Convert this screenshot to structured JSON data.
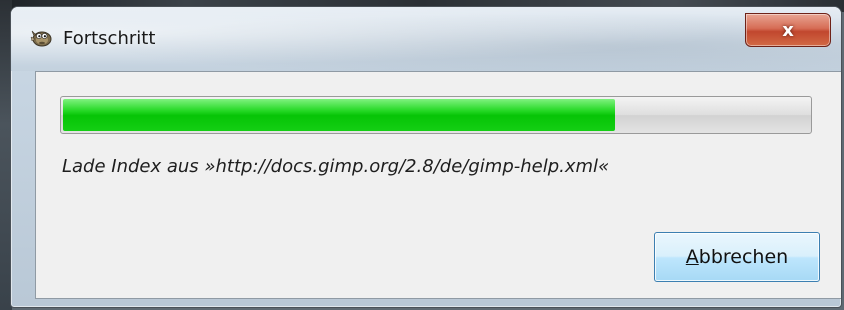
{
  "window": {
    "title": "Fortschritt",
    "app_icon": "gimp-wilber-icon",
    "close_glyph": "x"
  },
  "progress": {
    "fraction": 0.74,
    "fill_color": "#06c406"
  },
  "status": {
    "text": "Lade Index aus »http://docs.gimp.org/2.8/de/gimp-help.xml«"
  },
  "buttons": {
    "cancel_mnemonic": "A",
    "cancel_rest": "bbrechen"
  }
}
